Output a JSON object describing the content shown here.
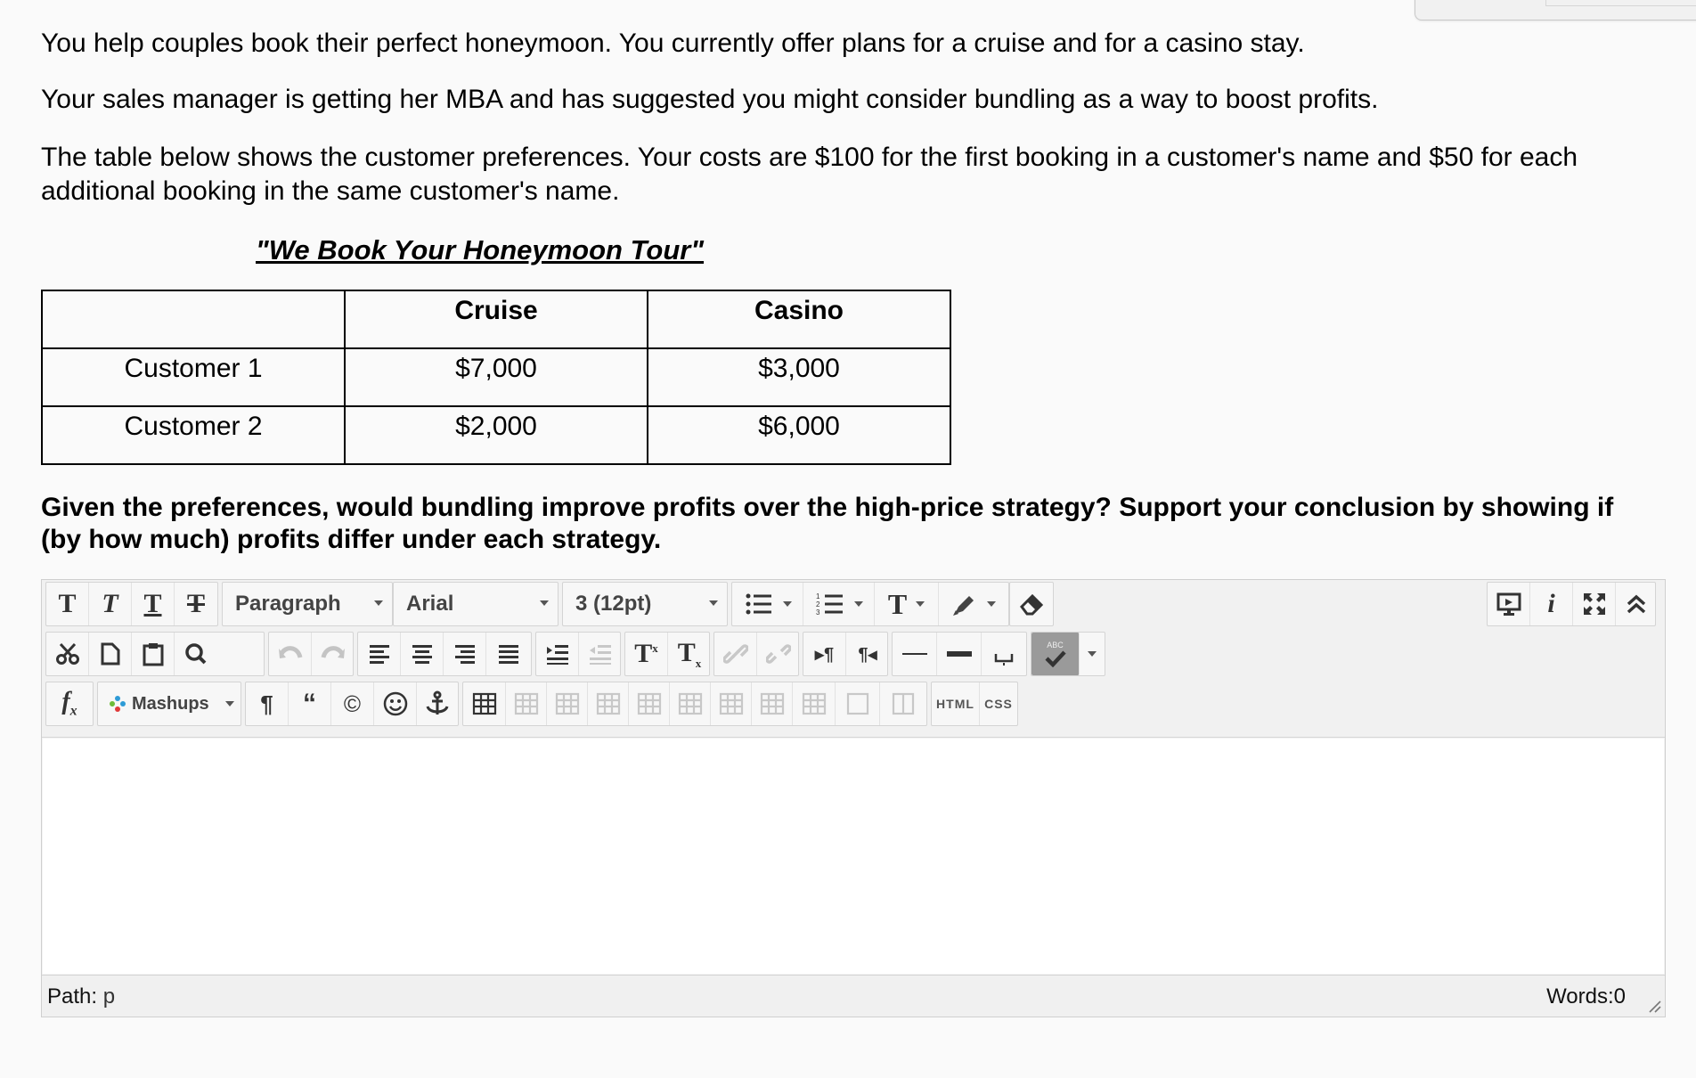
{
  "intro": {
    "p1": "You help couples book their perfect honeymoon.  You currently offer plans for a cruise and for a casino stay.",
    "p2": "Your sales manager is getting her MBA and has suggested you might consider bundling as a way to boost profits.",
    "p3": "The table below shows the customer preferences.  Your costs are $100 for the first booking in a customer's name and $50 for each additional booking in the same customer's name."
  },
  "table": {
    "title": "\"We Book Your Honeymoon Tour\"",
    "headers": [
      "",
      "Cruise",
      "Casino"
    ],
    "rows": [
      [
        "Customer 1",
        "$7,000",
        "$3,000"
      ],
      [
        "Customer 2",
        "$2,000",
        "$6,000"
      ]
    ]
  },
  "question": "Given the preferences, would bundling improve profits over the high-price strategy?   Support your conclusion by showing if (by how much) profits differ under each strategy.",
  "editor": {
    "format_select": "Paragraph",
    "font_select": "Arial",
    "size_select": "3 (12pt)",
    "mashups_label": "Mashups",
    "html_label": "HTML",
    "css_label": "CSS",
    "spell_label": "ABC",
    "path_label": "Path:",
    "path_value": "p",
    "words_label": "Words:0",
    "body_text": ""
  },
  "icons": [
    "bold-icon",
    "italic-icon",
    "underline-icon",
    "strikethrough-icon",
    "bullet-list-icon",
    "numbered-list-icon",
    "text-color-icon",
    "highlight-icon",
    "eraser-icon",
    "preview-icon",
    "info-icon",
    "fullscreen-icon",
    "collapse-icon",
    "cut-icon",
    "copy-icon",
    "paste-icon",
    "find-icon",
    "undo-icon",
    "redo-icon",
    "align-left-icon",
    "align-center-icon",
    "align-right-icon",
    "justify-icon",
    "indent-icon",
    "outdent-icon",
    "superscript-icon",
    "subscript-icon",
    "link-icon",
    "unlink-icon",
    "ltr-icon",
    "rtl-icon",
    "horizontal-rule-icon",
    "thick-rule-icon",
    "nonbreaking-space-icon",
    "spellcheck-icon",
    "formula-icon",
    "mashups-icon",
    "paragraph-mark-icon",
    "blockquote-icon",
    "copyright-icon",
    "emoticon-icon",
    "anchor-icon",
    "table-icon",
    "table-cell-icon",
    "column-icon",
    "resize-handle-icon"
  ]
}
